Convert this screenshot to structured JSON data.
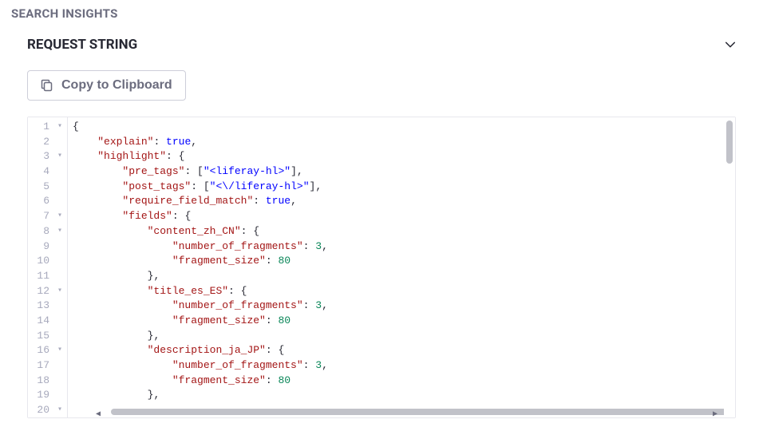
{
  "page": {
    "title": "SEARCH INSIGHTS"
  },
  "section": {
    "title": "REQUEST STRING"
  },
  "toolbar": {
    "copy_label": "Copy to Clipboard"
  },
  "code": {
    "lines": [
      {
        "num": 1,
        "fold": true,
        "indent": 0,
        "tokens": [
          {
            "t": "brace",
            "v": "{"
          }
        ]
      },
      {
        "num": 2,
        "fold": false,
        "indent": 1,
        "tokens": [
          {
            "t": "key",
            "v": "\"explain\""
          },
          {
            "t": "colon",
            "v": ": "
          },
          {
            "t": "bool",
            "v": "true"
          },
          {
            "t": "comma",
            "v": ","
          }
        ]
      },
      {
        "num": 3,
        "fold": true,
        "indent": 1,
        "tokens": [
          {
            "t": "key",
            "v": "\"highlight\""
          },
          {
            "t": "colon",
            "v": ": "
          },
          {
            "t": "brace",
            "v": "{"
          }
        ]
      },
      {
        "num": 4,
        "fold": false,
        "indent": 2,
        "tokens": [
          {
            "t": "key",
            "v": "\"pre_tags\""
          },
          {
            "t": "colon",
            "v": ": "
          },
          {
            "t": "bracket",
            "v": "["
          },
          {
            "t": "str",
            "v": "\"<liferay-hl>\""
          },
          {
            "t": "bracket",
            "v": "]"
          },
          {
            "t": "comma",
            "v": ","
          }
        ]
      },
      {
        "num": 5,
        "fold": false,
        "indent": 2,
        "tokens": [
          {
            "t": "key",
            "v": "\"post_tags\""
          },
          {
            "t": "colon",
            "v": ": "
          },
          {
            "t": "bracket",
            "v": "["
          },
          {
            "t": "str",
            "v": "\"<\\/liferay-hl>\""
          },
          {
            "t": "bracket",
            "v": "]"
          },
          {
            "t": "comma",
            "v": ","
          }
        ]
      },
      {
        "num": 6,
        "fold": false,
        "indent": 2,
        "tokens": [
          {
            "t": "key",
            "v": "\"require_field_match\""
          },
          {
            "t": "colon",
            "v": ": "
          },
          {
            "t": "bool",
            "v": "true"
          },
          {
            "t": "comma",
            "v": ","
          }
        ]
      },
      {
        "num": 7,
        "fold": true,
        "indent": 2,
        "tokens": [
          {
            "t": "key",
            "v": "\"fields\""
          },
          {
            "t": "colon",
            "v": ": "
          },
          {
            "t": "brace",
            "v": "{"
          }
        ]
      },
      {
        "num": 8,
        "fold": true,
        "indent": 3,
        "tokens": [
          {
            "t": "key",
            "v": "\"content_zh_CN\""
          },
          {
            "t": "colon",
            "v": ": "
          },
          {
            "t": "brace",
            "v": "{"
          }
        ]
      },
      {
        "num": 9,
        "fold": false,
        "indent": 4,
        "tokens": [
          {
            "t": "key",
            "v": "\"number_of_fragments\""
          },
          {
            "t": "colon",
            "v": ": "
          },
          {
            "t": "num",
            "v": "3"
          },
          {
            "t": "comma",
            "v": ","
          }
        ]
      },
      {
        "num": 10,
        "fold": false,
        "indent": 4,
        "tokens": [
          {
            "t": "key",
            "v": "\"fragment_size\""
          },
          {
            "t": "colon",
            "v": ": "
          },
          {
            "t": "num",
            "v": "80"
          }
        ]
      },
      {
        "num": 11,
        "fold": false,
        "indent": 3,
        "tokens": [
          {
            "t": "brace",
            "v": "}"
          },
          {
            "t": "comma",
            "v": ","
          }
        ]
      },
      {
        "num": 12,
        "fold": true,
        "indent": 3,
        "tokens": [
          {
            "t": "key",
            "v": "\"title_es_ES\""
          },
          {
            "t": "colon",
            "v": ": "
          },
          {
            "t": "brace",
            "v": "{"
          }
        ]
      },
      {
        "num": 13,
        "fold": false,
        "indent": 4,
        "tokens": [
          {
            "t": "key",
            "v": "\"number_of_fragments\""
          },
          {
            "t": "colon",
            "v": ": "
          },
          {
            "t": "num",
            "v": "3"
          },
          {
            "t": "comma",
            "v": ","
          }
        ]
      },
      {
        "num": 14,
        "fold": false,
        "indent": 4,
        "tokens": [
          {
            "t": "key",
            "v": "\"fragment_size\""
          },
          {
            "t": "colon",
            "v": ": "
          },
          {
            "t": "num",
            "v": "80"
          }
        ]
      },
      {
        "num": 15,
        "fold": false,
        "indent": 3,
        "tokens": [
          {
            "t": "brace",
            "v": "}"
          },
          {
            "t": "comma",
            "v": ","
          }
        ]
      },
      {
        "num": 16,
        "fold": true,
        "indent": 3,
        "tokens": [
          {
            "t": "key",
            "v": "\"description_ja_JP\""
          },
          {
            "t": "colon",
            "v": ": "
          },
          {
            "t": "brace",
            "v": "{"
          }
        ]
      },
      {
        "num": 17,
        "fold": false,
        "indent": 4,
        "tokens": [
          {
            "t": "key",
            "v": "\"number_of_fragments\""
          },
          {
            "t": "colon",
            "v": ": "
          },
          {
            "t": "num",
            "v": "3"
          },
          {
            "t": "comma",
            "v": ","
          }
        ]
      },
      {
        "num": 18,
        "fold": false,
        "indent": 4,
        "tokens": [
          {
            "t": "key",
            "v": "\"fragment_size\""
          },
          {
            "t": "colon",
            "v": ": "
          },
          {
            "t": "num",
            "v": "80"
          }
        ]
      },
      {
        "num": 19,
        "fold": false,
        "indent": 3,
        "tokens": [
          {
            "t": "brace",
            "v": "}"
          },
          {
            "t": "comma",
            "v": ","
          }
        ]
      },
      {
        "num": 20,
        "fold": true,
        "indent": 3,
        "tokens": []
      }
    ]
  }
}
